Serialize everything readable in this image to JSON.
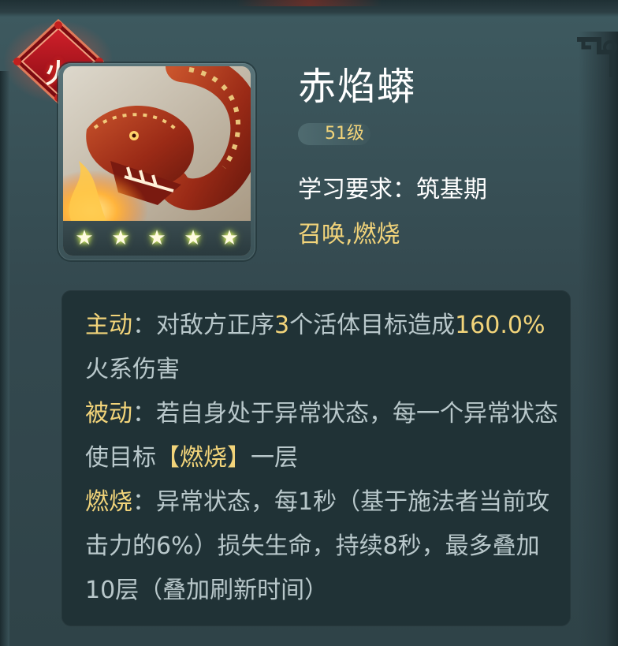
{
  "element_badge": {
    "label": "火",
    "color": "#b5121b"
  },
  "skill": {
    "name": "赤焰蟒",
    "level": "51级",
    "requirement": "学习要求：筑基期",
    "tags": "召唤,燃烧",
    "stars": 5
  },
  "description": {
    "active_label": "主动",
    "active_sep": "：",
    "active_text_1": "对敌方正序",
    "active_count": "3",
    "active_text_2": "个活体目标造成",
    "active_value": "160.0%",
    "active_text_3": "火系伤害",
    "passive_label": "被动",
    "passive_sep": "：",
    "passive_text_1": "若自身处于异常状态，每一个异常状态使目标",
    "passive_effect": "【燃烧】",
    "passive_text_2": "一层",
    "burn_label": "燃烧",
    "burn_sep": "：",
    "burn_text": "异常状态，每1秒（基于施法者当前攻击力的6%）损失生命，持续8秒，最多叠加10层（叠加刷新时间）"
  },
  "colors": {
    "accent_gold": "#f2d47a",
    "body_text": "#b9c8cb",
    "panel": "#3e5a60",
    "desc_bg": "#203236",
    "star_glow": "#e8ff6a"
  },
  "icons": [
    "fire-element-badge-icon",
    "fire-serpent-portrait",
    "star-icon",
    "corner-ornament-icon"
  ]
}
